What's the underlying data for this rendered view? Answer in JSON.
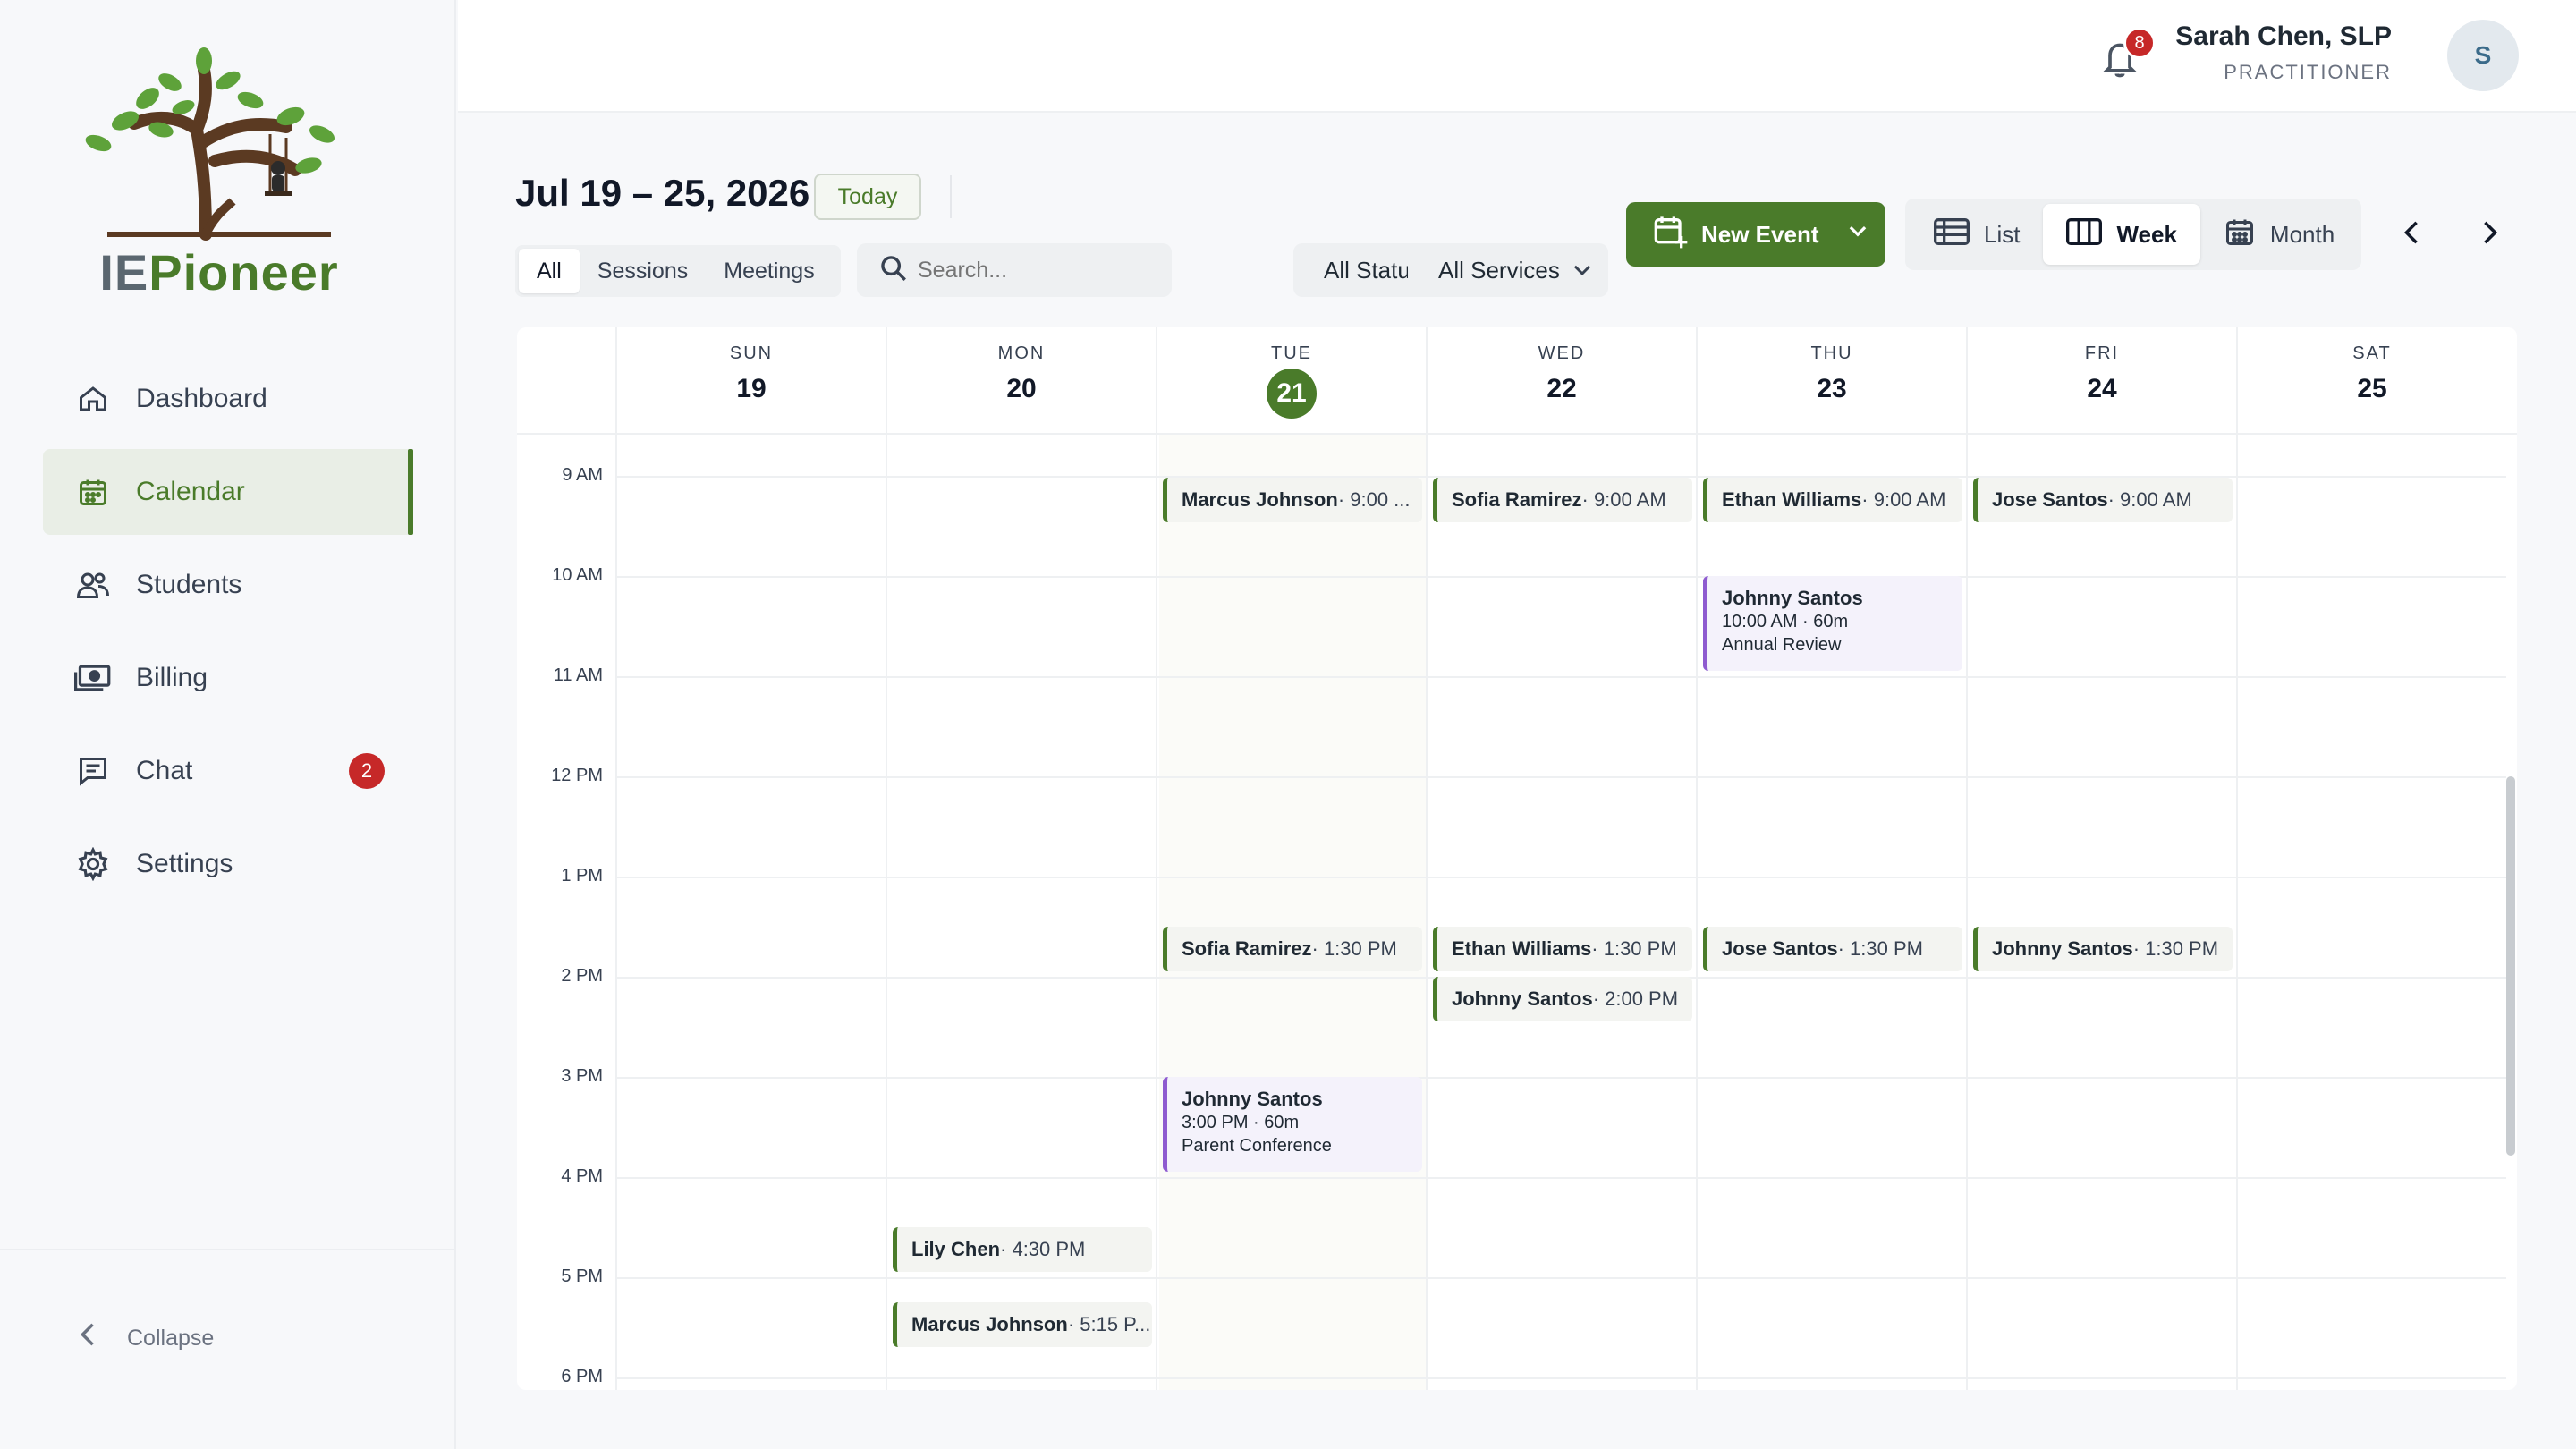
{
  "brand": {
    "name_part1": "IE",
    "name_part2": "Pioneer"
  },
  "sidebar": {
    "items": [
      {
        "label": "Dashboard",
        "icon": "home-icon"
      },
      {
        "label": "Calendar",
        "icon": "calendar-icon",
        "active": true
      },
      {
        "label": "Students",
        "icon": "users-icon"
      },
      {
        "label": "Billing",
        "icon": "money-icon"
      },
      {
        "label": "Chat",
        "icon": "chat-icon",
        "badge": "2"
      },
      {
        "label": "Settings",
        "icon": "gear-icon"
      }
    ],
    "collapse_label": "Collapse"
  },
  "header": {
    "notification_count": "8",
    "user_name": "Sarah Chen, SLP",
    "user_role": "PRACTITIONER",
    "avatar_initial": "S"
  },
  "toolbar": {
    "range": "Jul 19 – 25, 2026",
    "today_label": "Today",
    "filter_tabs": [
      "All",
      "Sessions",
      "Meetings"
    ],
    "search_placeholder": "Search...",
    "status_select": "All Statuses",
    "service_select": "All Services",
    "new_event_label": "New Event",
    "views": [
      "List",
      "Week",
      "Month"
    ],
    "active_view": "Week"
  },
  "calendar": {
    "days": [
      {
        "name": "SUN",
        "num": "19"
      },
      {
        "name": "MON",
        "num": "20"
      },
      {
        "name": "TUE",
        "num": "21",
        "today": true
      },
      {
        "name": "WED",
        "num": "22"
      },
      {
        "name": "THU",
        "num": "23"
      },
      {
        "name": "FRI",
        "num": "24"
      },
      {
        "name": "SAT",
        "num": "25"
      }
    ],
    "hours": [
      "9 AM",
      "10 AM",
      "11 AM",
      "12 PM",
      "1 PM",
      "2 PM",
      "3 PM",
      "4 PM",
      "5 PM",
      "6 PM"
    ],
    "events": [
      {
        "name": "Marcus Johnson",
        "time": " · 9:00 ..."
      },
      {
        "name": "Sofia Ramirez",
        "time": " · 9:00 AM"
      },
      {
        "name": "Ethan Williams",
        "time": " · 9:00 AM"
      },
      {
        "name": "Jose Santos",
        "time": " · 9:00 AM"
      },
      {
        "name": "Sofia Ramirez",
        "time": " · 1:30 PM"
      },
      {
        "name": "Ethan Williams",
        "time": " · 1:30 PM"
      },
      {
        "name": "Jose Santos",
        "time": " · 1:30 PM"
      },
      {
        "name": "Johnny Santos",
        "time": " · 1:30 PM"
      },
      {
        "name": "Johnny Santos",
        "time": " · 2:00 PM"
      },
      {
        "name": "Lily Chen",
        "time": " · 4:30 PM"
      },
      {
        "name": "Marcus Johnson",
        "time": " · 5:15 P..."
      }
    ],
    "long_events": [
      {
        "name": "Johnny Santos",
        "time": "10:00 AM · 60m",
        "type": "Annual Review"
      },
      {
        "name": "Johnny Santos",
        "time": "3:00 PM · 60m",
        "type": "Parent Conference"
      }
    ]
  },
  "colors": {
    "brand_green": "#4a7b2a",
    "meeting_purple": "#8e5bd0",
    "badge_red": "#c62828"
  }
}
